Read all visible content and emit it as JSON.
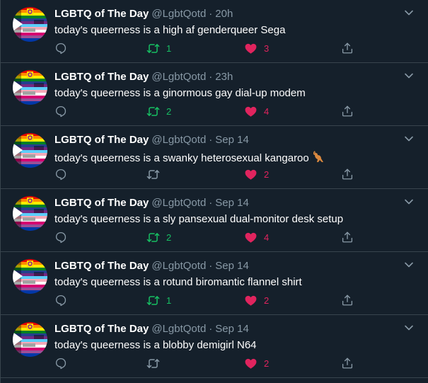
{
  "colors": {
    "background": "#15202b",
    "divider": "#38444d",
    "secondary_text": "#8899a6",
    "retweet_active": "#17bf63",
    "like_active": "#e0245e"
  },
  "icons": {
    "reply": "reply-icon",
    "retweet": "retweet-icon",
    "like": "heart-icon",
    "share": "share-icon",
    "menu": "chevron-down-icon",
    "emoji": "kangaroo-emoji"
  },
  "tweets": [
    {
      "name": "LGBTQ of The Day",
      "handle": "@LgbtQotd",
      "dot": "·",
      "time": "20h",
      "text": "today's queerness is a high af genderqueer Sega",
      "emoji": "",
      "retweets": "1",
      "likes": "3",
      "retweeted": true,
      "liked": true
    },
    {
      "name": "LGBTQ of The Day",
      "handle": "@LgbtQotd",
      "dot": "·",
      "time": "23h",
      "text": "today's queerness is a ginormous gay dial-up modem",
      "emoji": "",
      "retweets": "2",
      "likes": "4",
      "retweeted": true,
      "liked": true
    },
    {
      "name": "LGBTQ of The Day",
      "handle": "@LgbtQotd",
      "dot": "·",
      "time": "Sep 14",
      "text": "today's queerness is a swanky heterosexual kangaroo",
      "emoji": "🦘",
      "retweets": "",
      "likes": "2",
      "retweeted": false,
      "liked": true
    },
    {
      "name": "LGBTQ of The Day",
      "handle": "@LgbtQotd",
      "dot": "·",
      "time": "Sep 14",
      "text": "today's queerness is a sly pansexual dual-monitor desk setup",
      "emoji": "",
      "retweets": "2",
      "likes": "4",
      "retweeted": true,
      "liked": true
    },
    {
      "name": "LGBTQ of The Day",
      "handle": "@LgbtQotd",
      "dot": "·",
      "time": "Sep 14",
      "text": "today's queerness is a rotund biromantic flannel shirt",
      "emoji": "",
      "retweets": "1",
      "likes": "2",
      "retweeted": true,
      "liked": true
    },
    {
      "name": "LGBTQ of The Day",
      "handle": "@LgbtQotd",
      "dot": "·",
      "time": "Sep 14",
      "text": "today's queerness is a blobby demigirl N64",
      "emoji": "",
      "retweets": "",
      "likes": "2",
      "retweeted": false,
      "liked": true
    }
  ]
}
